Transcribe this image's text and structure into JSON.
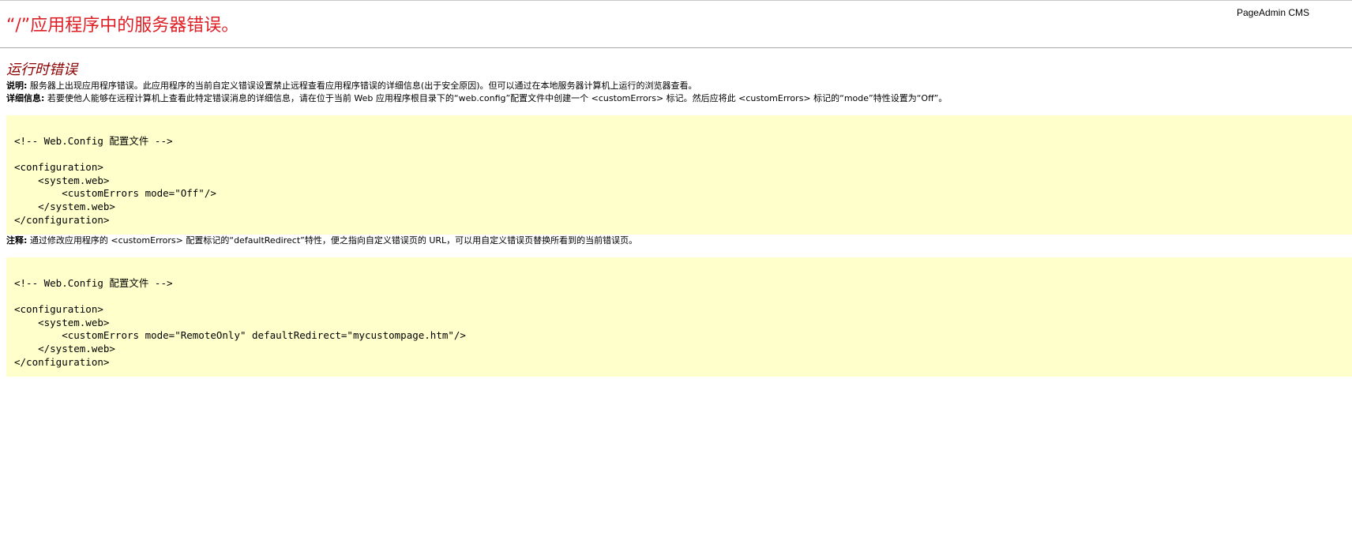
{
  "brand": "PageAdmin CMS",
  "title": "“/”应用程序中的服务器错误。",
  "section_title": "运行时错误",
  "description": {
    "label": "说明:",
    "text": " 服务器上出现应用程序错误。此应用程序的当前自定义错误设置禁止远程查看应用程序错误的详细信息(出于安全原因)。但可以通过在本地服务器计算机上运行的浏览器查看。"
  },
  "details": {
    "label": "详细信息:",
    "text": " 若要使他人能够在远程计算机上查看此特定错误消息的详细信息，请在位于当前 Web 应用程序根目录下的“web.config”配置文件中创建一个 <customErrors> 标记。然后应将此 <customErrors> 标记的“mode”特性设置为“Off”。"
  },
  "code_block_1": {
    "lines": [
      "<!-- Web.Config 配置文件 -->",
      "",
      "<configuration>",
      "    <system.web>",
      "        <customErrors mode=\"Off\"/>",
      "    </system.web>",
      "</configuration>"
    ]
  },
  "note": {
    "label": "注释:",
    "text": " 通过修改应用程序的 <customErrors> 配置标记的“defaultRedirect”特性，便之指向自定义错误页的 URL，可以用自定义错误页替换所看到的当前错误页。"
  },
  "code_block_2": {
    "lines": [
      "<!-- Web.Config 配置文件 -->",
      "",
      "<configuration>",
      "    <system.web>",
      "        <customErrors mode=\"RemoteOnly\" defaultRedirect=\"mycustompage.htm\"/>",
      "    </system.web>",
      "</configuration>"
    ]
  },
  "colors": {
    "title": "#dd1f26",
    "section_title": "#8b0000",
    "code_background": "#ffffcc"
  }
}
